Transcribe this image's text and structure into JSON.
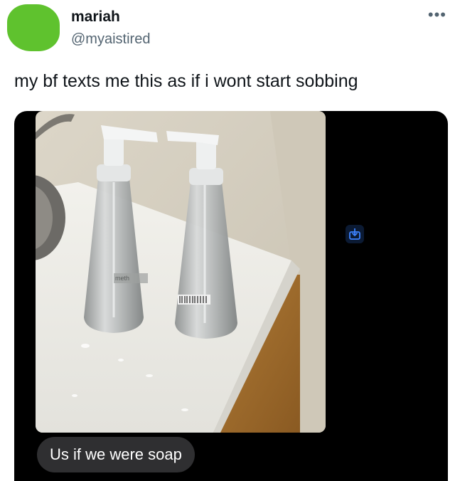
{
  "tweet": {
    "author_name": "mariah",
    "author_handle": "@myaistired",
    "text": "my bf texts me this as if i wont start sobbing",
    "more_icon": "more-horizontal-icon"
  },
  "media": {
    "message_text": "Us if we were soap",
    "save_icon": "download-icon",
    "bottle_label": "meth",
    "colors": {
      "avatar": "#5fc22e",
      "media_background": "#000000",
      "message_bubble": "#2f2f31",
      "save_icon_accent": "#3d82ff"
    }
  }
}
